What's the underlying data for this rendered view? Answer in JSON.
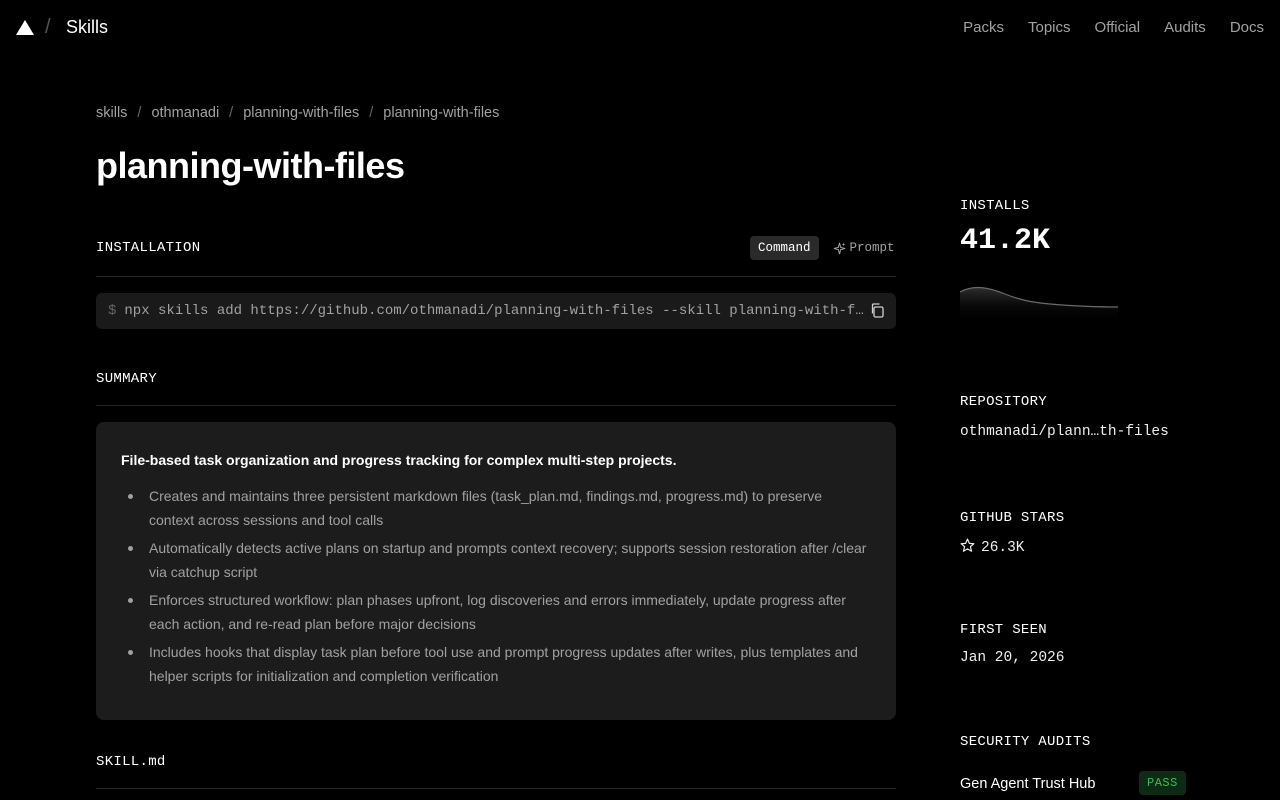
{
  "header": {
    "brand": "Skills",
    "nav": [
      "Packs",
      "Topics",
      "Official",
      "Audits",
      "Docs"
    ]
  },
  "breadcrumbs": [
    "skills",
    "othmanadi",
    "planning-with-files",
    "planning-with-files"
  ],
  "title": "planning-with-files",
  "installation": {
    "heading": "INSTALLATION",
    "tab_command": "Command",
    "tab_prompt": "Prompt",
    "prompt_symbol": "$",
    "command": "npx skills add https://github.com/othmanadi/planning-with-files --skill planning-with-files"
  },
  "summary": {
    "heading": "SUMMARY",
    "lead": "File-based task organization and progress tracking for complex multi-step projects.",
    "items": [
      "Creates and maintains three persistent markdown files (task_plan.md, findings.md, progress.md) to preserve context across sessions and tool calls",
      "Automatically detects active plans on startup and prompts context recovery; supports session restoration after /clear via catchup script",
      "Enforces structured workflow: plan phases upfront, log discoveries and errors immediately, update progress after each action, and re-read plan before major decisions",
      "Includes hooks that display task plan before tool use and prompt progress updates after writes, plus templates and helper scripts for initialization and completion verification"
    ]
  },
  "skill_md": {
    "heading": "SKILL.md"
  },
  "sidebar": {
    "installs_label": "INSTALLS",
    "installs_value": "41.2K",
    "repository_label": "REPOSITORY",
    "repository_value": "othmanadi/plann…th-files",
    "stars_label": "GITHUB STARS",
    "stars_value": "26.3K",
    "first_seen_label": "FIRST SEEN",
    "first_seen_value": "Jan 20, 2026",
    "audits_label": "SECURITY AUDITS",
    "audit_name": "Gen Agent Trust Hub",
    "audit_status": "PASS"
  },
  "colors": {
    "background": "#000000",
    "panel": "#1c1c1c",
    "pass": "#2fbf5a"
  }
}
